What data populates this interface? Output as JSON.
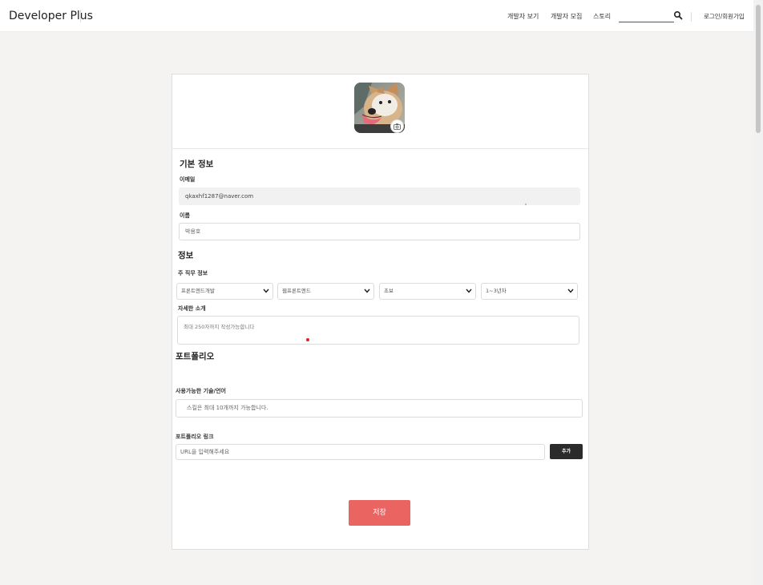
{
  "header": {
    "brand": "Developer Plus",
    "nav": [
      "개발자 보기",
      "개발자 모집",
      "스토리"
    ],
    "login_label": "로그인/회원가입"
  },
  "profile": {
    "basic_title": "기본 정보",
    "email_label": "이메일",
    "email_value": "qkaxhf1287@naver.com",
    "name_label": "이름",
    "name_value": "박용호",
    "info_title": "정보",
    "job_label": "주 직무 정보",
    "selects": [
      "프론트엔드개발",
      "웹프론트엔드",
      "초보",
      "1~3년차"
    ],
    "intro_label": "자세한 소개",
    "intro_placeholder": "최대 250자까지 작성가능합니다",
    "portfolio_title": "포트폴리오",
    "skills_label": "사용가능한 기술/언어",
    "skills_placeholder": "스킬은 최대 10개까지 가능합니다.",
    "link_label": "포트폴리오 링크",
    "link_placeholder": "URL을 입력해주세요",
    "add_button": "추가",
    "save_button": "저장"
  },
  "colors": {
    "accent": "#ea6562",
    "dark_button": "#2b2b2b",
    "page_bg": "#f4f3f1"
  }
}
